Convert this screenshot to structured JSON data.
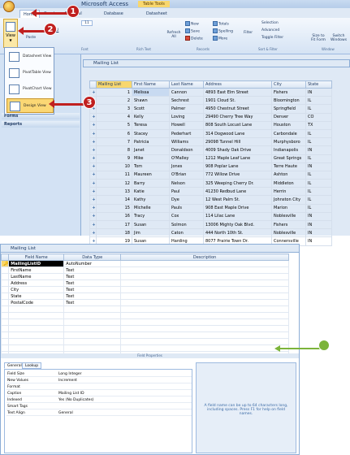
{
  "app": {
    "window_title": "Microsoft Access",
    "contextual_tab": "Table Tools",
    "tabs": [
      "Home",
      "Create",
      "External Data",
      "Database Tools",
      "Datasheet"
    ]
  },
  "ribbon": {
    "view_label": "View",
    "paste_label": "Paste",
    "font_size": "11",
    "groups": [
      "Views",
      "Clipboard",
      "Font",
      "Rich Text",
      "Records",
      "Sort & Filter",
      "Window"
    ],
    "buttons": {
      "refresh_all": "Refresh All",
      "new": "New",
      "save": "Save",
      "delete": "Delete",
      "totals": "Totals",
      "spelling": "Spelling",
      "more": "More",
      "filter": "Filter",
      "selection": "Selection",
      "advanced": "Advanced",
      "toggle_filter": "Toggle Filter",
      "size_to_fit_form": "Size to Fit Form",
      "switch_windows": "Switch Windows"
    }
  },
  "view_menu": {
    "items": [
      "Datasheet View",
      "PivotTable View",
      "PivotChart View",
      "Design View"
    ],
    "selected": "Design View"
  },
  "nav_pane": {
    "groups": [
      "Forms",
      "Reports"
    ]
  },
  "datasheet": {
    "title": "Mailing List",
    "columns": [
      "Mailing List",
      "First Name",
      "Last Name",
      "Address",
      "City",
      "State"
    ],
    "rows": [
      [
        "1",
        "Melissa",
        "Cannon",
        "4893 East Elm Street",
        "Fishers",
        "IN"
      ],
      [
        "2",
        "Shawn",
        "Sechrest",
        "1901 Cloud St.",
        "Bloomington",
        "IL"
      ],
      [
        "3",
        "Scott",
        "Palmer",
        "4950 Chestnut Street",
        "Springfield",
        "IL"
      ],
      [
        "4",
        "Kelly",
        "Loving",
        "29490 Cherry Tree Way",
        "Denver",
        "CO"
      ],
      [
        "5",
        "Teresa",
        "Howell",
        "808 South Locust Lane",
        "Houston",
        "TX"
      ],
      [
        "6",
        "Stacey",
        "Pederhart",
        "314 Dogwood Lane",
        "Carbondale",
        "IL"
      ],
      [
        "7",
        "Patricia",
        "Williams",
        "29098 Tunnel Hill",
        "Murphysboro",
        "IL"
      ],
      [
        "8",
        "Janet",
        "Donaldson",
        "4009 Shady Oak Drive",
        "Indianapolis",
        "IN"
      ],
      [
        "9",
        "Mike",
        "O'Malley",
        "1212 Maple Leaf Lane",
        "Great Springs",
        "IL"
      ],
      [
        "10",
        "Tom",
        "Jones",
        "908 Poplar Lane",
        "Terre Haute",
        "IN"
      ],
      [
        "11",
        "Maureen",
        "O'Brian",
        "772 Willow Drive",
        "Ashton",
        "IL"
      ],
      [
        "12",
        "Barry",
        "Nelson",
        "325 Weeping Cherry Dr.",
        "Middleton",
        "IL"
      ],
      [
        "13",
        "Katie",
        "Paul",
        "41230 Redbud Lane",
        "Herrin",
        "IL"
      ],
      [
        "14",
        "Kathy",
        "Dye",
        "12 West Palm St.",
        "Johnston City",
        "IL"
      ],
      [
        "15",
        "Michelle",
        "Pauls",
        "908 East Maple Drive",
        "Marion",
        "IL"
      ],
      [
        "16",
        "Tracy",
        "Cox",
        "114 Lilac Lane",
        "Noblesville",
        "IN"
      ],
      [
        "17",
        "Susan",
        "Solmon",
        "13006 Mighty Oak Blvd.",
        "Fishers",
        "IN"
      ],
      [
        "18",
        "Jim",
        "Caton",
        "444 North 10th St.",
        "Noblesville",
        "IN"
      ],
      [
        "19",
        "Susan",
        "Harding",
        "8077 Prairie Town Dr.",
        "Connersville",
        "IN"
      ]
    ]
  },
  "design_view": {
    "title": "Mailing List",
    "columns": [
      "Field Name",
      "Data Type",
      "Description"
    ],
    "fields": [
      [
        "MailingListID",
        "AutoNumber",
        ""
      ],
      [
        "FirstName",
        "Text",
        ""
      ],
      [
        "LastName",
        "Text",
        ""
      ],
      [
        "Address",
        "Text",
        ""
      ],
      [
        "City",
        "Text",
        ""
      ],
      [
        "State",
        "Text",
        ""
      ],
      [
        "PostalCode",
        "Text",
        ""
      ]
    ],
    "field_properties_label": "Field Properties",
    "property_tabs": [
      "General",
      "Lookup"
    ],
    "properties": [
      [
        "Field Size",
        "Long Integer"
      ],
      [
        "New Values",
        "Increment"
      ],
      [
        "Format",
        ""
      ],
      [
        "Caption",
        "Mailing List ID"
      ],
      [
        "Indexed",
        "Yes (No Duplicates)"
      ],
      [
        "Smart Tags",
        ""
      ],
      [
        "Text Align",
        "General"
      ]
    ],
    "help_text": "A field name can be up to 64 characters long, including spaces. Press F1 for help on field names."
  },
  "callouts": [
    "1",
    "2",
    "3"
  ],
  "colors": {
    "callout_red": "#c0201f",
    "callout_green": "#7cb43a",
    "ribbon_blue": "#dfe9f5"
  }
}
